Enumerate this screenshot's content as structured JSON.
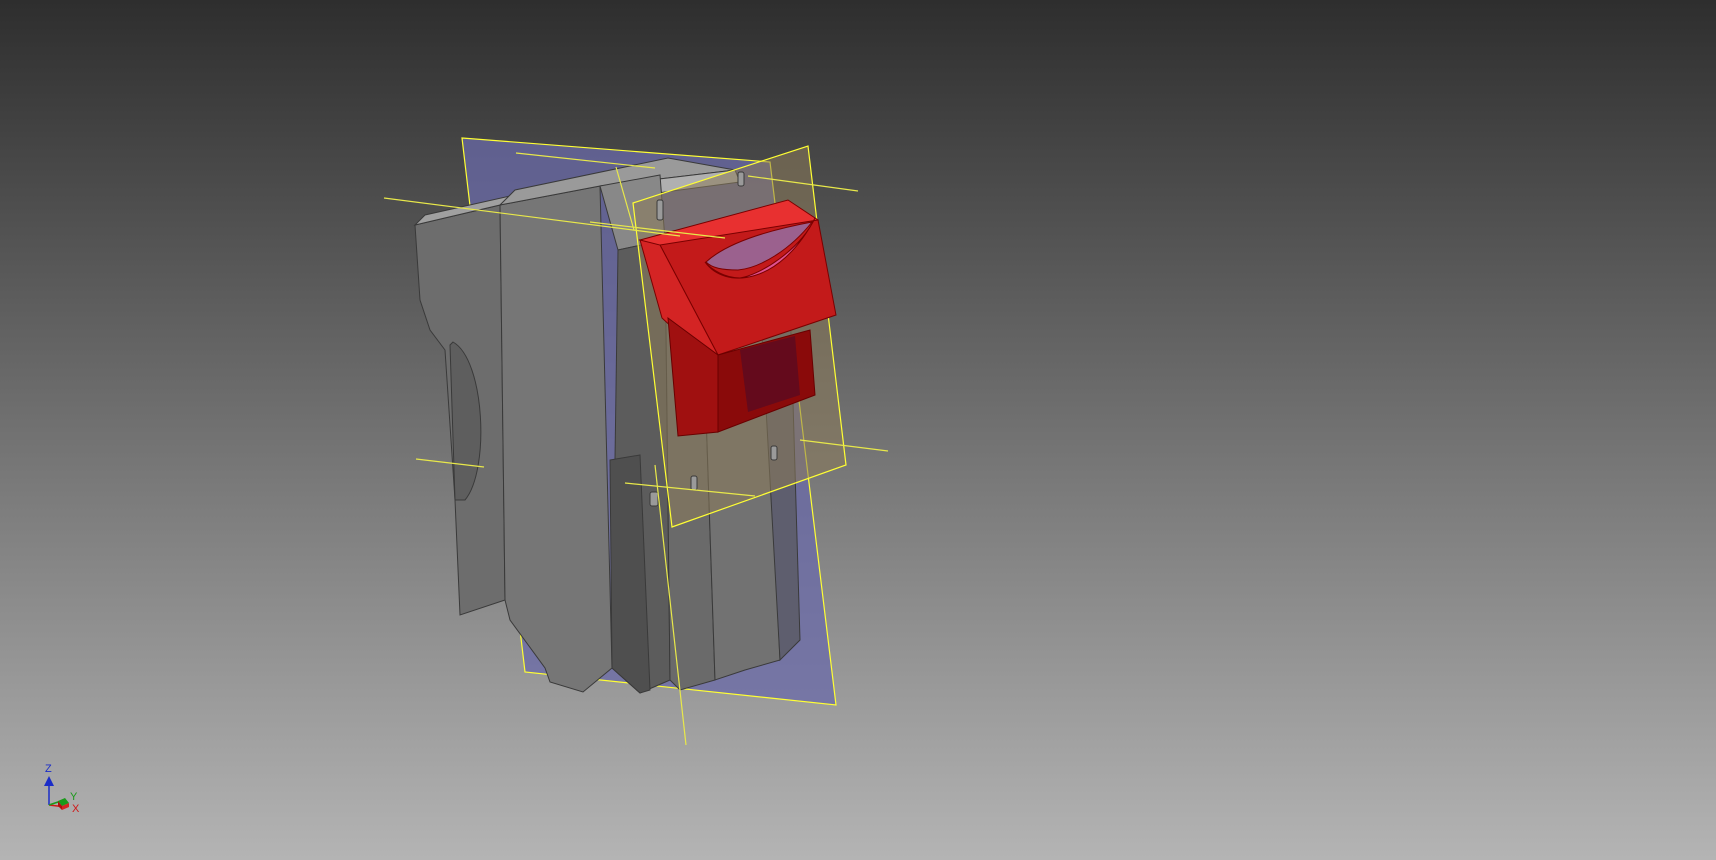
{
  "viewport": {
    "background_top": "#2e2e2e",
    "background_bottom": "#b4b4b4"
  },
  "model": {
    "body_color": "#6f6f6f",
    "body_shadow_color": "#5a5a5a",
    "body_highlight_color": "#8a8a8a",
    "selected_part_color": "#b01010",
    "plane_color": "#6a6aa8",
    "plane_outline_color": "#ffff33",
    "work_axis_color": "#e8e84a"
  },
  "view_triad": {
    "z_label": "Z",
    "y_label": "Y",
    "x_label": "X",
    "z_color": "#1a2cc8",
    "y_color": "#1a9a1a",
    "x_color": "#d01818"
  }
}
